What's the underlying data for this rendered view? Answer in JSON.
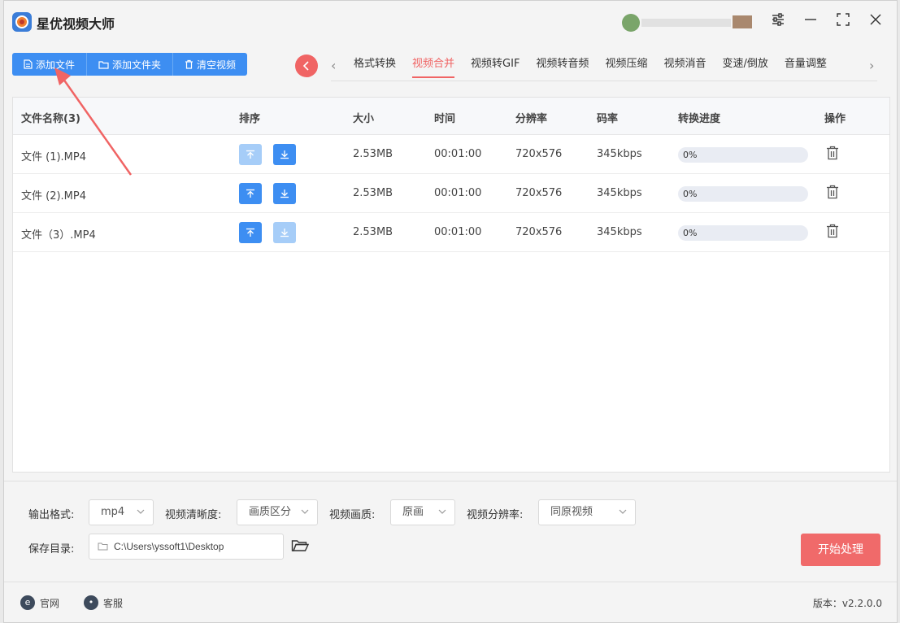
{
  "app": {
    "title": "星优视频大师"
  },
  "toolbar": {
    "add_file": "添加文件",
    "add_folder": "添加文件夹",
    "clear_videos": "清空视频"
  },
  "tabs": [
    {
      "label": "格式转换",
      "active": false
    },
    {
      "label": "视频合并",
      "active": true
    },
    {
      "label": "视频转GIF",
      "active": false
    },
    {
      "label": "视频转音频",
      "active": false
    },
    {
      "label": "视频压缩",
      "active": false
    },
    {
      "label": "视频消音",
      "active": false
    },
    {
      "label": "变速/倒放",
      "active": false
    },
    {
      "label": "音量调整",
      "active": false
    }
  ],
  "table": {
    "headers": {
      "name": "文件名称(3)",
      "sort": "排序",
      "size": "大小",
      "time": "时间",
      "resolution": "分辨率",
      "bitrate": "码率",
      "progress": "转换进度",
      "action": "操作"
    },
    "rows": [
      {
        "name": "文件 (1).MP4",
        "size": "2.53MB",
        "time": "00:01:00",
        "resolution": "720x576",
        "bitrate": "345kbps",
        "progress_text": "0%",
        "progress": 0,
        "up_enabled": false,
        "down_enabled": true
      },
      {
        "name": "文件 (2).MP4",
        "size": "2.53MB",
        "time": "00:01:00",
        "resolution": "720x576",
        "bitrate": "345kbps",
        "progress_text": "0%",
        "progress": 0,
        "up_enabled": true,
        "down_enabled": true
      },
      {
        "name": "文件（3）.MP4",
        "size": "2.53MB",
        "time": "00:01:00",
        "resolution": "720x576",
        "bitrate": "345kbps",
        "progress_text": "0%",
        "progress": 0,
        "up_enabled": true,
        "down_enabled": false
      }
    ]
  },
  "settings": {
    "output_format_label": "输出格式:",
    "output_format_value": "mp4",
    "clarity_label": "视频清晰度:",
    "clarity_value": "画质区分",
    "quality_label": "视频画质:",
    "quality_value": "原画",
    "resolution_label": "视频分辨率:",
    "resolution_value": "同原视频",
    "save_dir_label": "保存目录:",
    "save_dir_value": "C:\\Users\\yssoft1\\Desktop",
    "start_label": "开始处理"
  },
  "footer": {
    "website": "官网",
    "support": "客服",
    "version": "版本：v2.2.0.0"
  },
  "colors": {
    "primary": "#3d8ef2",
    "primary_disabled": "#a6cdf8",
    "accent": "#f06464",
    "start_button": "#f06a6a"
  }
}
